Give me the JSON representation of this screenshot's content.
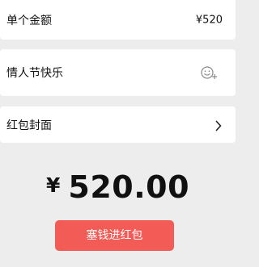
{
  "rows": {
    "amount": {
      "label": "单个金额",
      "value": "¥520"
    },
    "greeting": {
      "label": "情人节快乐",
      "icon": "emoji-add-icon"
    },
    "cover": {
      "label": "红包封面",
      "icon": "chevron-right-icon"
    }
  },
  "total": {
    "currency": "¥",
    "amount": "520.00"
  },
  "submit": {
    "label": "塞钱进红包"
  },
  "colors": {
    "background": "#ededed",
    "card": "#ffffff",
    "button": "#f25b56",
    "text": "#111111",
    "icon": "#8a8a8a"
  }
}
